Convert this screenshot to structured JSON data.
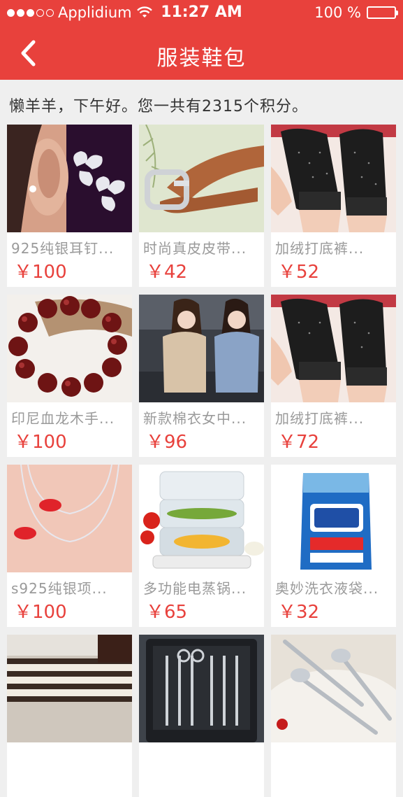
{
  "status_bar": {
    "carrier": "Applidium",
    "time": "11:27 AM",
    "battery": "100 %"
  },
  "nav": {
    "title": "服装鞋包",
    "back_icon": "chevron-left-icon"
  },
  "greeting": "懒羊羊，下午好。您一共有2315个积分。",
  "products": [
    {
      "name": "925纯银耳钉...",
      "price": "￥100"
    },
    {
      "name": "时尚真皮皮带...",
      "price": "￥42"
    },
    {
      "name": "加绒打底裤...",
      "price": "￥52"
    },
    {
      "name": "印尼血龙木手...",
      "price": "￥100"
    },
    {
      "name": "新款棉衣女中...",
      "price": "￥96"
    },
    {
      "name": "加绒打底裤...",
      "price": "￥72"
    },
    {
      "name": "s925纯银项...",
      "price": "￥100"
    },
    {
      "name": "多功能电蒸锅...",
      "price": "￥65"
    },
    {
      "name": "奥妙洗衣液袋...",
      "price": "￥32"
    },
    {
      "name": "",
      "price": ""
    },
    {
      "name": "",
      "price": ""
    },
    {
      "name": "",
      "price": ""
    }
  ],
  "colors": {
    "accent": "#e8413c",
    "background": "#efefef"
  }
}
